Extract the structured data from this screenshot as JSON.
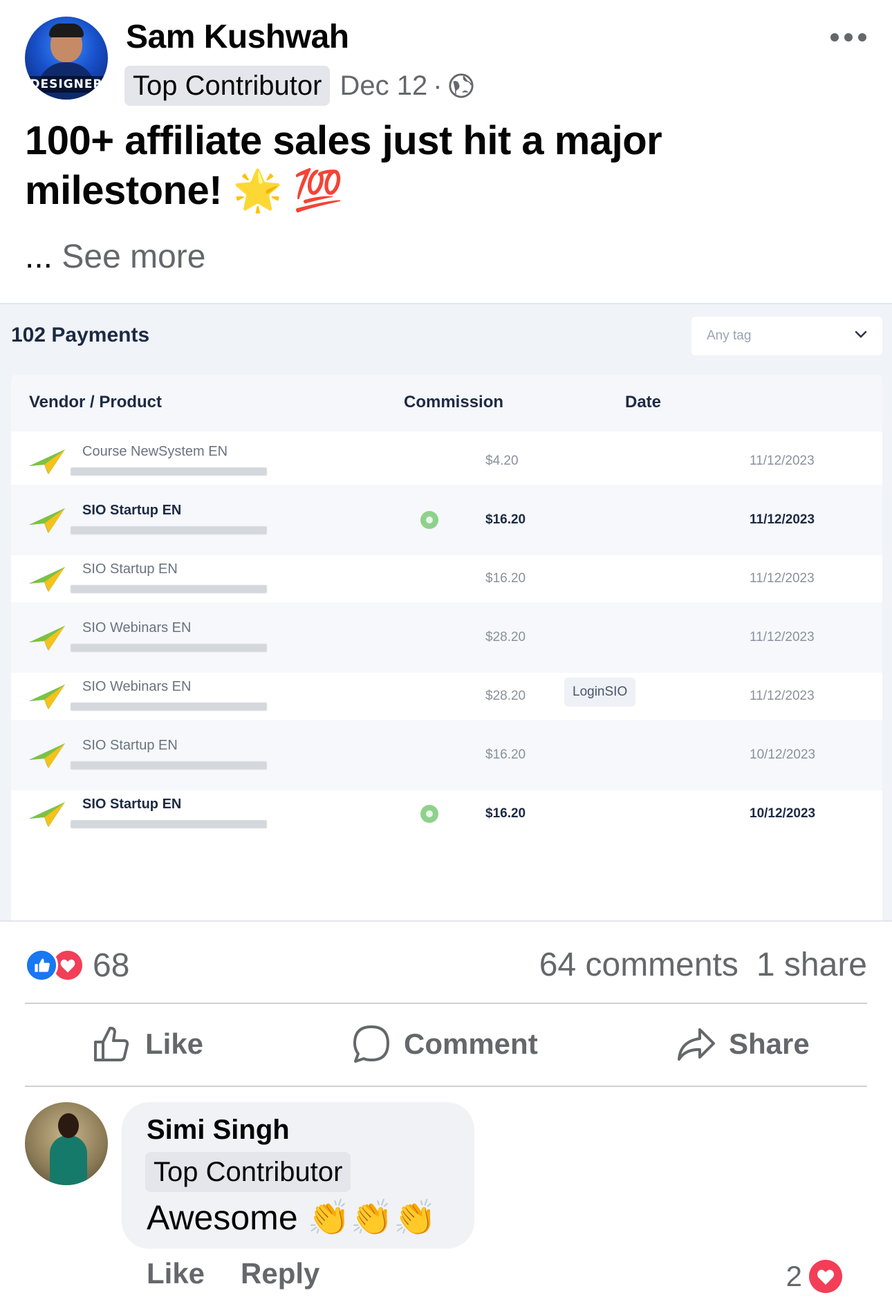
{
  "post": {
    "author": "Sam Kushwah",
    "avatar_text": "DESIGNER",
    "badge": "Top Contributor",
    "date": "Dec 12",
    "separator": "·",
    "audience_icon": "globe-icon",
    "menu_icon": "more-horizontal-icon",
    "text": "100+ affiliate sales just hit a major milestone! 🌟 💯",
    "ellipsis": "...",
    "see_more": "See more"
  },
  "screenshot": {
    "title": "102 Payments",
    "tag_select": {
      "placeholder": "Any tag"
    },
    "columns": {
      "vendor": "Vendor / Product",
      "commission": "Commission",
      "date": "Date"
    },
    "rows": [
      {
        "product": "Course NewSystem EN",
        "commission": "$4.20",
        "date": "11/12/2023",
        "emphasis": false,
        "status": false,
        "tag": ""
      },
      {
        "product": "SIO Startup EN",
        "commission": "$16.20",
        "date": "11/12/2023",
        "emphasis": true,
        "status": true,
        "tag": ""
      },
      {
        "product": "SIO Startup EN",
        "commission": "$16.20",
        "date": "11/12/2023",
        "emphasis": false,
        "status": false,
        "tag": ""
      },
      {
        "product": "SIO Webinars EN",
        "commission": "$28.20",
        "date": "11/12/2023",
        "emphasis": false,
        "status": false,
        "tag": ""
      },
      {
        "product": "SIO Webinars EN",
        "commission": "$28.20",
        "date": "11/12/2023",
        "emphasis": false,
        "status": false,
        "tag": "LoginSIO"
      },
      {
        "product": "SIO Startup EN",
        "commission": "$16.20",
        "date": "10/12/2023",
        "emphasis": false,
        "status": false,
        "tag": ""
      },
      {
        "product": "SIO Startup EN",
        "commission": "$16.20",
        "date": "10/12/2023",
        "emphasis": true,
        "status": true,
        "tag": ""
      }
    ]
  },
  "engagement": {
    "reaction_count": "68",
    "comments": "64 comments",
    "shares": "1 share"
  },
  "actions": {
    "like": "Like",
    "comment": "Comment",
    "share": "Share"
  },
  "comment": {
    "author": "Simi Singh",
    "badge": "Top Contributor",
    "text": "Awesome 👏👏👏",
    "like": "Like",
    "reply": "Reply",
    "reaction_count": "2"
  },
  "colors": {
    "like_blue": "#1877f2",
    "love_red": "#f33e58",
    "muted_text": "#65676b"
  }
}
